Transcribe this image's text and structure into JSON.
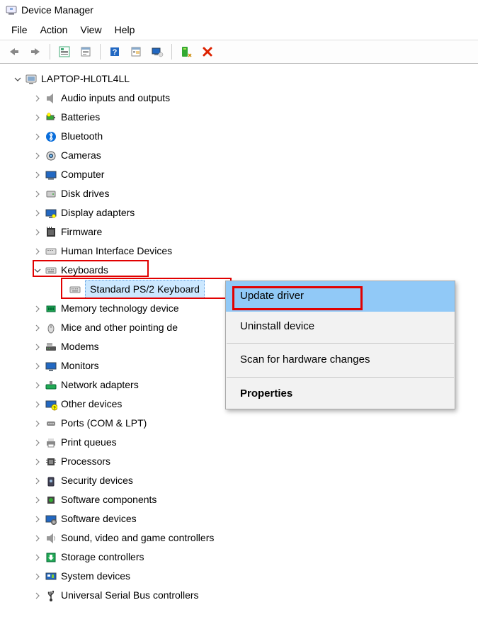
{
  "window": {
    "title": "Device Manager"
  },
  "menubar": {
    "file": "File",
    "action": "Action",
    "view": "View",
    "help": "Help"
  },
  "toolbar": {
    "back": "back-icon",
    "forward": "forward-icon",
    "show_hide": "show-hide-tree-icon",
    "properties": "properties-icon",
    "help": "help-icon",
    "action_sheet": "action-sheet-icon",
    "monitor": "remote-monitor-icon",
    "plug": "scan-hardware-icon",
    "delete": "delete-icon"
  },
  "tree": {
    "root": "LAPTOP-HL0TL4LL",
    "items": [
      {
        "label": "Audio inputs and outputs",
        "icon": "speaker"
      },
      {
        "label": "Batteries",
        "icon": "battery"
      },
      {
        "label": "Bluetooth",
        "icon": "bluetooth"
      },
      {
        "label": "Cameras",
        "icon": "camera"
      },
      {
        "label": "Computer",
        "icon": "computer"
      },
      {
        "label": "Disk drives",
        "icon": "disk"
      },
      {
        "label": "Display adapters",
        "icon": "display"
      },
      {
        "label": "Firmware",
        "icon": "firmware"
      },
      {
        "label": "Human Interface Devices",
        "icon": "hid"
      },
      {
        "label": "Keyboards",
        "icon": "keyboard",
        "expanded": true,
        "highlighted": true
      },
      {
        "label": "Memory technology device",
        "icon": "memory"
      },
      {
        "label": "Mice and other pointing de",
        "icon": "mouse"
      },
      {
        "label": "Modems",
        "icon": "modem"
      },
      {
        "label": "Monitors",
        "icon": "monitor"
      },
      {
        "label": "Network adapters",
        "icon": "network"
      },
      {
        "label": "Other devices",
        "icon": "other"
      },
      {
        "label": "Ports (COM & LPT)",
        "icon": "port"
      },
      {
        "label": "Print queues",
        "icon": "printer"
      },
      {
        "label": "Processors",
        "icon": "cpu"
      },
      {
        "label": "Security devices",
        "icon": "security"
      },
      {
        "label": "Software components",
        "icon": "swcomp"
      },
      {
        "label": "Software devices",
        "icon": "swdev"
      },
      {
        "label": "Sound, video and game controllers",
        "icon": "sound"
      },
      {
        "label": "Storage controllers",
        "icon": "storage"
      },
      {
        "label": "System devices",
        "icon": "system"
      },
      {
        "label": "Universal Serial Bus controllers",
        "icon": "usb"
      }
    ],
    "keyboard_child": "Standard PS/2 Keyboard"
  },
  "context_menu": {
    "update_driver": "Update driver",
    "uninstall_device": "Uninstall device",
    "scan": "Scan for hardware changes",
    "properties": "Properties"
  }
}
